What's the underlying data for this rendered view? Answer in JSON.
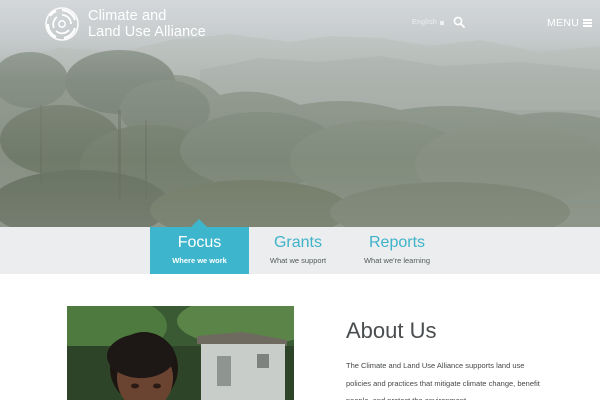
{
  "header": {
    "logo_line1": "Climate and",
    "logo_line2": "Land Use Alliance",
    "language": "English",
    "menu_label": "MENU",
    "icons": [
      "logo-icon",
      "chevron-down-icon",
      "search-icon",
      "hamburger-icon"
    ]
  },
  "nav": {
    "tabs": [
      {
        "label": "Focus",
        "sub": "Where we work",
        "active": true
      },
      {
        "label": "Grants",
        "sub": "What we support",
        "active": false
      },
      {
        "label": "Reports",
        "sub": "What we're learning",
        "active": false
      }
    ],
    "accent_color": "#3db5cc",
    "band_color": "#ebedee"
  },
  "about": {
    "title": "About Us",
    "body": "The Climate and Land Use Alliance supports land use policies and practices that mitigate climate change, benefit people, and protect the environment."
  }
}
